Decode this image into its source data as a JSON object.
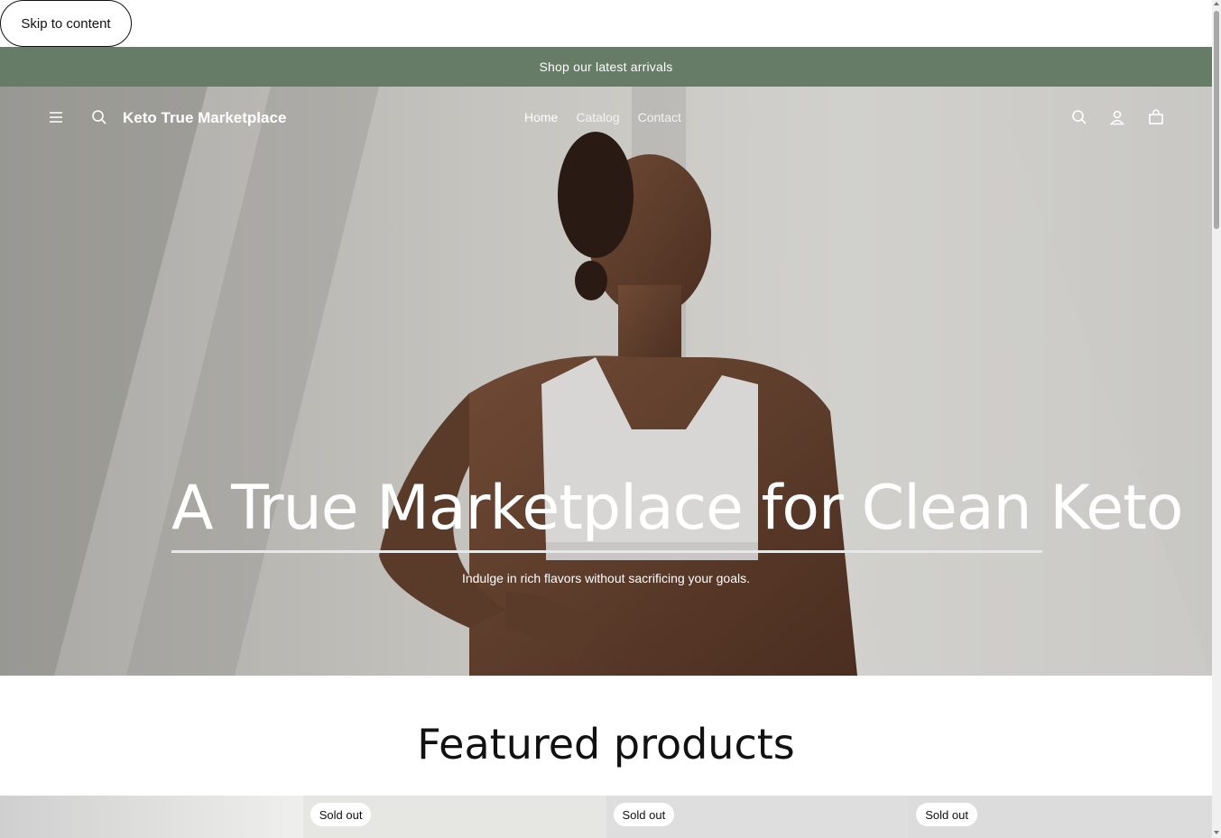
{
  "skip_link": "Skip to content",
  "announcement": "Shop our latest arrivals",
  "header": {
    "brand": "Keto True Marketplace",
    "nav": [
      "Home",
      "Catalog",
      "Contact"
    ],
    "icons": [
      "menu-icon",
      "search-icon",
      "search-icon",
      "account-icon",
      "cart-icon"
    ]
  },
  "hero": {
    "title": "A True Marketplace for Clean Keto",
    "subtitle": "Indulge in rich flavors without sacrificing your goals."
  },
  "featured": {
    "title": "Featured products",
    "badges": [
      "Sold out",
      "Sold out",
      "Sold out"
    ]
  },
  "colors": {
    "announcement_bg": "#667c66",
    "text": "#111111"
  }
}
